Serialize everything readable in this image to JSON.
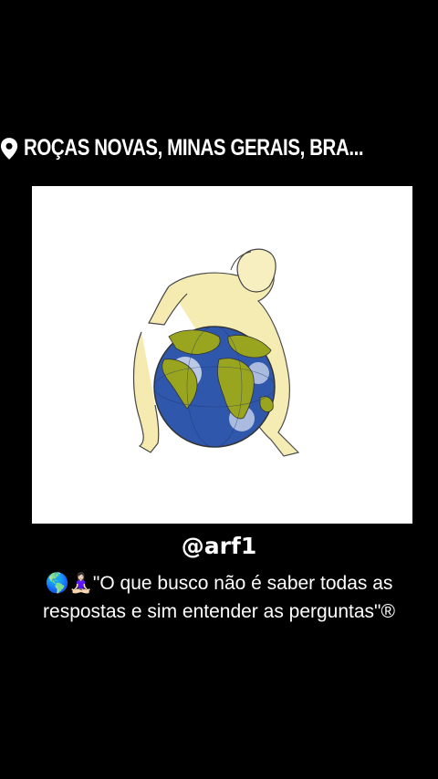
{
  "location": {
    "icon": "map-pin-icon",
    "text": "ROÇAS NOVAS, MINAS GERAIS, BRA..."
  },
  "photo": {
    "description_icon": "earth-globe-drawing"
  },
  "mention": {
    "text": "@arf1"
  },
  "caption": {
    "emojis": "🌎🧘🏻‍♀️",
    "text": "\"O que busco não é saber todas as respostas e sim entender as perguntas\"®"
  },
  "colors": {
    "background": "#000000",
    "text": "#ffffff",
    "photo_bg": "#ffffff",
    "ocean": "#2e55a8",
    "land": "#9aa51f",
    "skin": "#f3e6a6"
  }
}
